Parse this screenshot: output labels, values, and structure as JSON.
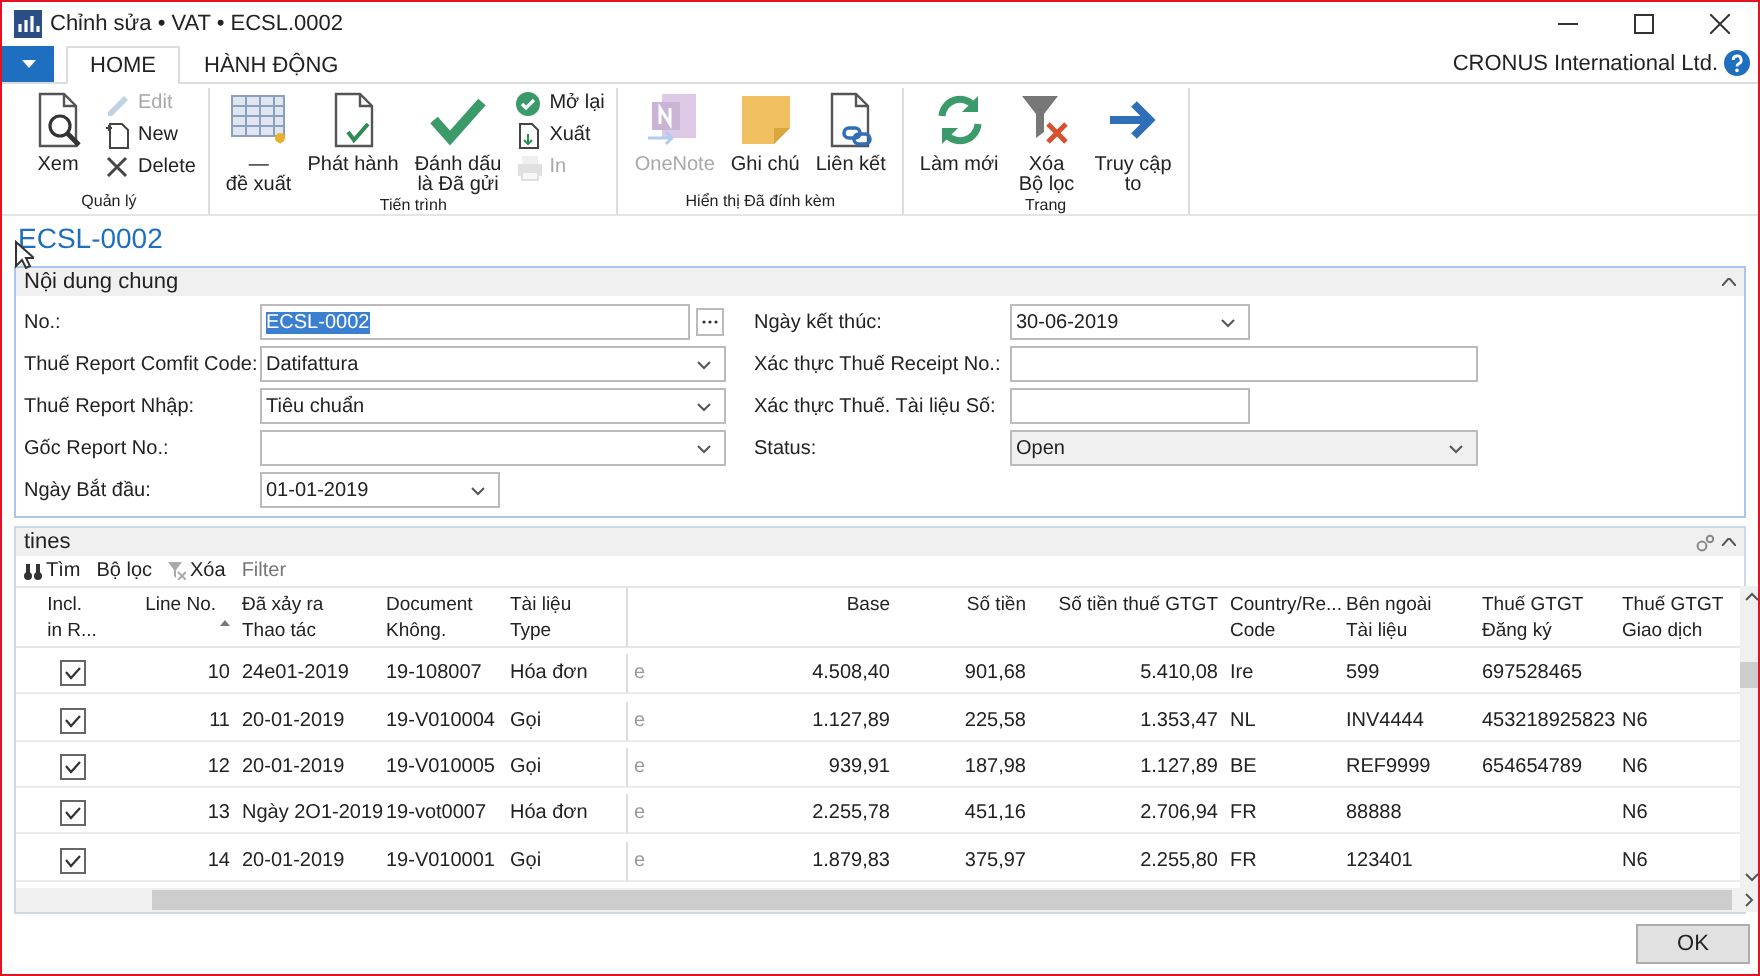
{
  "window": {
    "title": "Chỉnh sửa • VAT • ECSL.0002"
  },
  "tabs": [
    {
      "label": "HOME",
      "selected": true
    },
    {
      "label": "HÀNH ĐỘNG",
      "selected": false
    }
  ],
  "company": "CRONUS International Ltd.",
  "ribbon": {
    "groups": [
      {
        "label": "Quản lý",
        "items": [
          {
            "kind": "large",
            "label": "Xem",
            "disabled": false
          },
          {
            "kind": "small",
            "label": "Edit",
            "disabled": true
          },
          {
            "kind": "small",
            "label": "New",
            "disabled": false
          },
          {
            "kind": "small",
            "label": "Delete",
            "disabled": false
          }
        ]
      },
      {
        "label": "Tiến trình",
        "items": [
          {
            "kind": "large",
            "label": "—\nđề xuất",
            "disabled": false
          },
          {
            "kind": "large",
            "label": "Phát hành",
            "disabled": false
          },
          {
            "kind": "large",
            "label": "Đánh dấu\nlà Đã gửi",
            "disabled": false
          },
          {
            "kind": "small",
            "label": "Mở lại",
            "disabled": false
          },
          {
            "kind": "small",
            "label": "Xuất",
            "disabled": false
          },
          {
            "kind": "small",
            "label": "In",
            "disabled": true
          }
        ]
      },
      {
        "label": "Hiển thị Đã đính kèm",
        "items": [
          {
            "kind": "large",
            "label": "OneNote",
            "disabled": true
          },
          {
            "kind": "large",
            "label": "Ghi chú",
            "disabled": false
          },
          {
            "kind": "large",
            "label": "Liên kết",
            "disabled": false
          }
        ]
      },
      {
        "label": "Trang",
        "items": [
          {
            "kind": "large",
            "label": "Làm mới",
            "disabled": false
          },
          {
            "kind": "large",
            "label": "Xóa\nBộ lọc",
            "disabled": false
          },
          {
            "kind": "large",
            "label": "Truy cập\nto",
            "disabled": false
          }
        ]
      }
    ]
  },
  "page_title": "ECSL-0002",
  "general": {
    "title": "Nội dung chung",
    "expanded": true,
    "left_fields": [
      {
        "label": "No.:",
        "kind": "lookup",
        "value": "ECSL-0002",
        "selected": true,
        "disabled": false
      },
      {
        "label": "Thuế Report Comfit Code:",
        "kind": "dropdown",
        "value": "Datifattura",
        "selected": false,
        "disabled": false
      },
      {
        "label": "Thuế Report Nhập:",
        "kind": "dropdown",
        "value": "Tiêu chuẩn",
        "selected": false,
        "disabled": false
      },
      {
        "label": "Gốc Report No.:",
        "kind": "dropdown",
        "selected": false,
        "disabled": false
      },
      {
        "label": "Ngày Bắt đầu:",
        "kind": "date",
        "value": "01-01-2019",
        "selected": false,
        "disabled": false
      }
    ],
    "right_fields": [
      {
        "label": "Ngày kết thúc:",
        "kind": "date",
        "value": "30-06-2019",
        "selected": false,
        "disabled": false
      },
      {
        "label": "Xác thực Thuế Receipt No.:",
        "kind": "text",
        "selected": false,
        "disabled": false
      },
      {
        "label": "Xác thực Thuế. Tài liệu Số:",
        "kind": "short_text",
        "selected": false,
        "disabled": false
      },
      {
        "label": "Status:",
        "kind": "dropdown",
        "value": "Open",
        "selected": false,
        "disabled": true
      }
    ]
  },
  "lines": {
    "title": "tines",
    "expanded": true,
    "toolbar": [
      {
        "label": "Tìm",
        "disabled": false
      },
      {
        "label": "Bộ lọc",
        "disabled": false
      },
      {
        "label": "Xóa",
        "disabled": false
      }
    ],
    "filter_placeholder": "Filter",
    "columns": [
      {
        "label": "Incl.\nin R...",
        "sorted": false
      },
      {
        "label": "Line No.",
        "sorted": true
      },
      {
        "label": "Đã xảy ra\nThao tác",
        "sorted": false
      },
      {
        "label": "Document\nKhông.",
        "sorted": false
      },
      {
        "label": "Tài liệu\nType",
        "sorted": false
      },
      {
        "sorted": false
      },
      {
        "label": "Base",
        "sorted": false
      },
      {
        "label": "Số tiền",
        "sorted": false
      },
      {
        "label": "Số tiền thuế GTGT",
        "sorted": false
      },
      {
        "label": "Country/Re...\nCode",
        "sorted": false
      },
      {
        "label": "Bên ngoài\nTài liệu",
        "sorted": false
      },
      {
        "label": "Thuế GTGT\nĐăng ký",
        "sorted": false
      },
      {
        "label": "Thuế GTGT\nGiao dịch",
        "sorted": false
      }
    ],
    "rows": [
      {
        "cells": [
          {
            "kind": "checkbox",
            "checked": true
          },
          "10",
          "24e01-2019",
          "19-108007",
          "Hóa đơn",
          "e",
          "4.508,40",
          "901,68",
          "5.410,08",
          "Ire",
          "599",
          "697528465",
          null
        ]
      },
      {
        "cells": [
          {
            "kind": "checkbox",
            "checked": true
          },
          "11",
          "20-01-2019",
          "19-V010004",
          "Gọi",
          "e",
          "1.127,89",
          "225,58",
          "1.353,47",
          "NL",
          "INV4444",
          "453218925823",
          "N6"
        ]
      },
      {
        "cells": [
          {
            "kind": "checkbox",
            "checked": true
          },
          "12",
          "20-01-2019",
          "19-V010005",
          "Gọi",
          "e",
          "939,91",
          "187,98",
          "1.127,89",
          "BE",
          "REF9999",
          "654654789",
          "N6"
        ]
      },
      {
        "cells": [
          {
            "kind": "checkbox",
            "checked": true
          },
          "13",
          "Ngày 2O1-2019",
          "19-vot0007",
          "Hóa đơn",
          "e",
          "2.255,78",
          "451,16",
          "2.706,94",
          "FR",
          "88888",
          null,
          "N6"
        ]
      },
      {
        "cells": [
          {
            "kind": "checkbox",
            "checked": true
          },
          "14",
          "20-01-2019",
          "19-V010001",
          "Gọi",
          "e",
          "1.879,83",
          "375,97",
          "2.255,80",
          "FR",
          "123401",
          null,
          "N6"
        ]
      }
    ]
  },
  "buttons": [
    "OK"
  ]
}
